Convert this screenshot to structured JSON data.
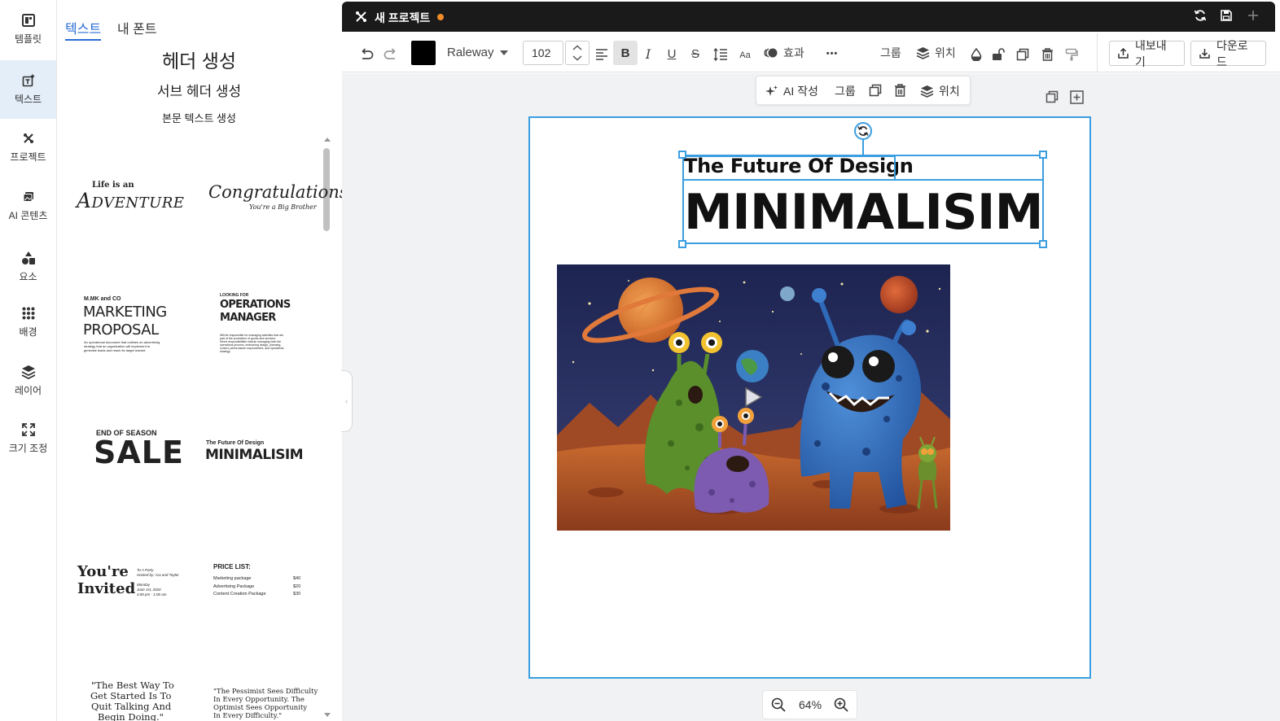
{
  "rail": {
    "items": [
      {
        "label": "템플릿",
        "icon": "template-icon"
      },
      {
        "label": "텍스트",
        "icon": "text-add-icon"
      },
      {
        "label": "프로젝트",
        "icon": "project-icon"
      },
      {
        "label": "AI 콘텐츠",
        "icon": "ai-content-icon"
      },
      {
        "label": "요소",
        "icon": "elements-icon"
      },
      {
        "label": "배경",
        "icon": "background-grid-icon"
      },
      {
        "label": "레이어",
        "icon": "layers-icon"
      },
      {
        "label": "크기 조정",
        "icon": "resize-icon"
      }
    ]
  },
  "panel": {
    "tabs": [
      "텍스트",
      "내 폰트"
    ],
    "add_header": "헤더 생성",
    "add_subheader": "서브 헤더 생성",
    "add_body": "본문 텍스트 생성",
    "templates": {
      "adventure": {
        "small": "Life is an",
        "big": "Adventure"
      },
      "congrats": {
        "big": "Congratulations!",
        "small": "You're a Big Brother"
      },
      "marketing": {
        "kicker": "M.MK and CO",
        "line1": "MARKETING",
        "line2": "PROPOSAL",
        "body1": "An operational document that outlines an advertising",
        "body2": "strategy that an organization will implement to",
        "body3": "generate leads and reach its target market."
      },
      "operations": {
        "kicker": "LOOKING FOR",
        "line1": "OPERATIONS",
        "line2": "MANAGER",
        "body1": "Will be responsible for managing activities that are",
        "body2": "part of the production of goods and services.",
        "body3": "Direct responsibilities include managing both the",
        "body4": "operations process, embracing design, planning,",
        "body5": "control, performance improvement, and operations",
        "body6": "strategy."
      },
      "sale": {
        "kicker": "END OF SEASON",
        "big": "SALE"
      },
      "minimal": {
        "kicker": "The Future Of Design",
        "big": "MINIMALISIM"
      },
      "invited": {
        "line1": "You're",
        "line2": "Invited",
        "d1": "To A Party",
        "d2": "Hosted by: Ara and Taylor",
        "d3": "Monday",
        "d4": "June 1st, 2020",
        "d5": "4:00 pm - 1:00 am"
      },
      "price": {
        "title": "PRICE LIST:",
        "rows": [
          {
            "name": "Marketing package",
            "price": "$40"
          },
          {
            "name": "Advertising Package",
            "price": "$20"
          },
          {
            "name": "Content Creation Package",
            "price": "$30"
          }
        ]
      },
      "quote1": {
        "l1": "\"The Best Way To",
        "l2": "Get Started Is To",
        "l3": "Quit Talking And",
        "l4": "Begin Doing.\""
      },
      "quote2": {
        "l1": "\"The Pessimist Sees Difficulty",
        "l2": "In Every Opportunity. The",
        "l3": "Optimist Sees Opportunity",
        "l4": "In Every Difficulty.\""
      }
    }
  },
  "topbar": {
    "title": "새 프로젝트",
    "unsaved_color": "#f28c28",
    "icons": [
      "sync-icon",
      "save-icon",
      "plus-icon"
    ]
  },
  "toolbar": {
    "font": "Raleway",
    "font_size": "102",
    "text_color": "#000000",
    "bold_label": "B",
    "italic_label": "I",
    "underline_label": "U",
    "strike_label": "S",
    "case_label": "Aa",
    "effects_label": "효과",
    "more_label": "•••",
    "group_label": "그룹",
    "position_label": "위치",
    "export_label": "내보내기",
    "download_label": "다운로드"
  },
  "float_bar": {
    "ai_label": "AI 작성",
    "group_label": "그룹",
    "position_label": "위치"
  },
  "canvas": {
    "subtitle": "The Future Of Design",
    "title": "MINIMALISIM",
    "accent": "#3a9ee0"
  },
  "zoom": {
    "level": "64%"
  }
}
